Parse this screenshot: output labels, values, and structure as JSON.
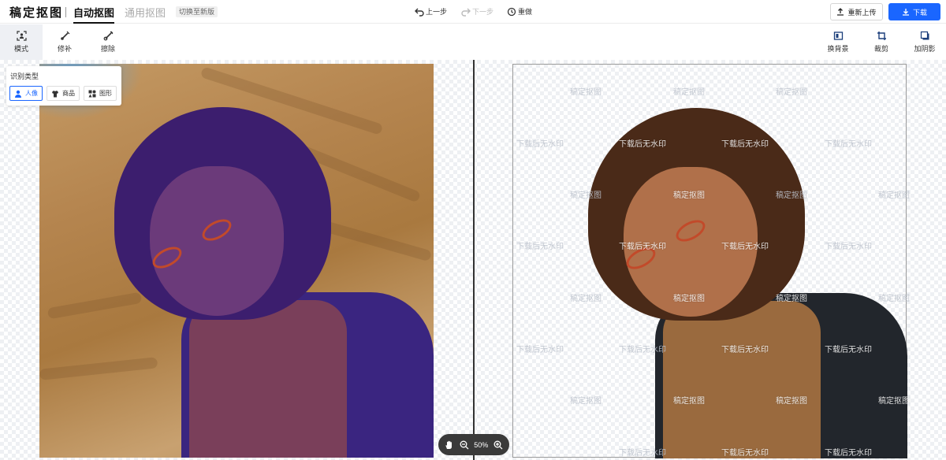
{
  "app": {
    "logo": "稿定抠图"
  },
  "tabs": [
    {
      "label": "自动抠图",
      "active": true
    },
    {
      "label": "通用抠图",
      "active": false
    }
  ],
  "switch_badge": "切换至新版",
  "history": {
    "undo": "上一步",
    "redo": "下一步",
    "reset": "重做"
  },
  "actions": {
    "reupload": "重新上传",
    "download": "下载"
  },
  "tools_left": [
    {
      "label": "模式",
      "icon": "mode-icon",
      "active": true
    },
    {
      "label": "修补",
      "icon": "brush-icon",
      "active": false
    },
    {
      "label": "擦除",
      "icon": "eraser-icon",
      "active": false
    }
  ],
  "tools_right": [
    {
      "label": "换背景",
      "icon": "background-icon"
    },
    {
      "label": "裁剪",
      "icon": "crop-icon"
    },
    {
      "label": "加阴影",
      "icon": "shadow-icon"
    }
  ],
  "recognition": {
    "title": "识别类型",
    "options": [
      {
        "label": "人像",
        "icon": "person-icon",
        "selected": true
      },
      {
        "label": "商品",
        "icon": "shirt-icon",
        "selected": false
      },
      {
        "label": "图形",
        "icon": "shapes-icon",
        "selected": false
      }
    ]
  },
  "watermarks": {
    "brand": "稿定抠图",
    "download_hint": "下载后无水印"
  },
  "zoom": {
    "level": "50%"
  },
  "colors": {
    "accent": "#1a66ff",
    "overlay_purple": "#3c1e8c"
  }
}
